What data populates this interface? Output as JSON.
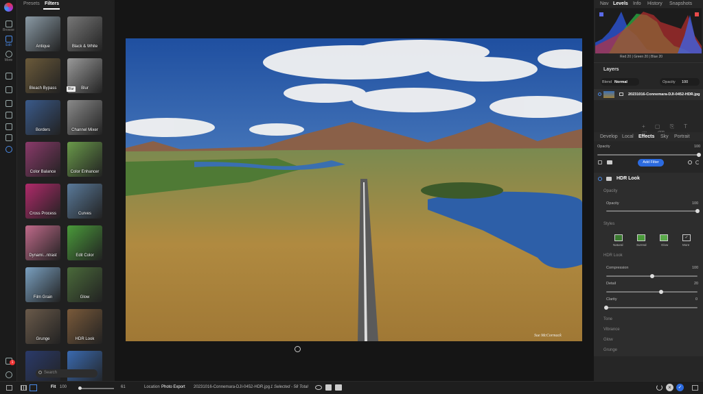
{
  "left_rail": {
    "items": [
      {
        "label": "Browse"
      },
      {
        "label": "Edit"
      },
      {
        "label": "More"
      }
    ]
  },
  "filters_panel": {
    "tabs": [
      "Presets",
      "Filters"
    ],
    "active_tab": "Filters",
    "search_placeholder": "Search",
    "tooltip": "Blur",
    "thumbnails": [
      {
        "label": "Antique",
        "color": "#8a9aa5"
      },
      {
        "label": "Black & White",
        "color": "#777777"
      },
      {
        "label": "Bleach Bypass",
        "color": "#6b5a3a"
      },
      {
        "label": "Blur",
        "color": "#9a9a9a"
      },
      {
        "label": "Borders",
        "color": "#3a5a8a"
      },
      {
        "label": "Channel Mixer",
        "color": "#8a8a8a"
      },
      {
        "label": "Color Balance",
        "color": "#8a3a6a"
      },
      {
        "label": "Color Enhancer",
        "color": "#6a9a4a"
      },
      {
        "label": "Cross Process",
        "color": "#b02a6a"
      },
      {
        "label": "Curves",
        "color": "#5a7a9a"
      },
      {
        "label": "Dynami...ntrast",
        "color": "#c06a8a"
      },
      {
        "label": "Edit Color",
        "color": "#4a9a3a"
      },
      {
        "label": "Film Grain",
        "color": "#7aa0c0"
      },
      {
        "label": "Glow",
        "color": "#4a6a3a"
      },
      {
        "label": "Grunge",
        "color": "#6a5a4a"
      },
      {
        "label": "HDR Look",
        "color": "#7a5a3a"
      },
      {
        "label": "",
        "color": "#2a3a6a"
      },
      {
        "label": "",
        "color": "#3a6ab0"
      }
    ]
  },
  "right_panel": {
    "tabs": [
      "Nav",
      "Levels",
      "Info",
      "History",
      "Snapshots"
    ],
    "active_tab": "Levels",
    "histogram_readout": "Red  20   | Green  20   | Blue  20",
    "layers": {
      "title": "Layers",
      "blend_label": "Blend",
      "blend_value": "Normal",
      "opacity_label": "Opacity",
      "opacity_value": "100",
      "layer_name": "20231016-Connemara-DJI-0452-HDR.jpg"
    },
    "edit_tabs": [
      "Develop",
      "Local",
      "Effects",
      "Sky",
      "Portrait"
    ],
    "active_edit_tab": "Effects",
    "effects": {
      "opacity_label": "Opacity",
      "opacity_value": "100",
      "opacity_level": 1.0,
      "add_filter": "Add Filter",
      "filter_title": "HDR Look",
      "section_opacity": "Opacity",
      "inner_opacity_label": "Opacity",
      "inner_opacity_value": "100",
      "inner_opacity_level": 1.0,
      "styles_title": "Styles",
      "styles": [
        "Natural",
        "Surreal",
        "Glow",
        "More"
      ],
      "hdr_title": "HDR Look",
      "compression_label": "Compression",
      "compression_value": "100",
      "compression_level": 0.5,
      "detail_label": "Detail",
      "detail_value": "20",
      "detail_level": 0.6,
      "clarity_label": "Clarity",
      "clarity_value": "0",
      "clarity_level": 0.0,
      "collapsed": [
        "Tone",
        "Vibrance",
        "Glow",
        "Grunge"
      ]
    }
  },
  "bottom_bar": {
    "fit_label": "Fit",
    "zoom_value": "100",
    "thumb_size": "61",
    "location_label": "Location",
    "location_value": "Photo Export",
    "filename": "20231016-Connemara-DJI-0452-HDR.jpg",
    "selection": "1 Selected - 58 Total",
    "badge_count": "1"
  },
  "photo": {
    "watermark": "Sue McCormack",
    "sky_color": "#3a6fb5",
    "land_color": "#a0803a"
  }
}
